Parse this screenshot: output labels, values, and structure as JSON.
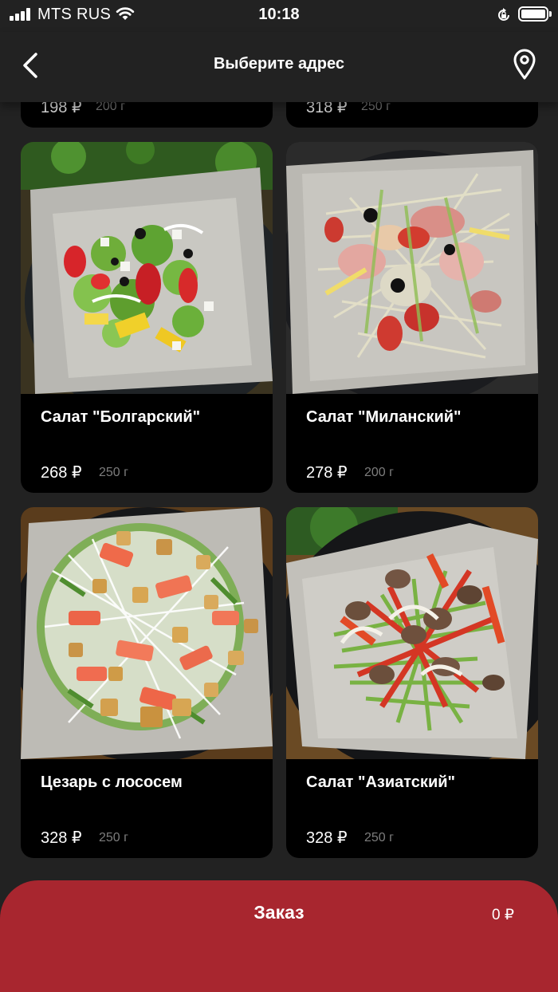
{
  "status_bar": {
    "carrier": "MTS RUS",
    "time": "10:18"
  },
  "header": {
    "title": "Выберите адрес",
    "back_icon": "chevron-left-icon",
    "location_icon": "map-pin-icon"
  },
  "partial_items": [
    {
      "price": "198 ₽",
      "weight": "200 г"
    },
    {
      "price": "318 ₽",
      "weight": "250 г"
    }
  ],
  "items": [
    {
      "name": "Салат \"Болгарский\"",
      "price": "268 ₽",
      "weight": "250 г"
    },
    {
      "name": "Салат \"Миланский\"",
      "price": "278 ₽",
      "weight": "200 г"
    },
    {
      "name": "Цезарь с лососем",
      "price": "328 ₽",
      "weight": "250 г"
    },
    {
      "name": "Салат \"Азиатский\"",
      "price": "328 ₽",
      "weight": "250 г"
    }
  ],
  "order": {
    "label": "Заказ",
    "total": "0 ₽"
  },
  "colors": {
    "background": "#222222",
    "card": "#000000",
    "accent": "#a8262f"
  }
}
